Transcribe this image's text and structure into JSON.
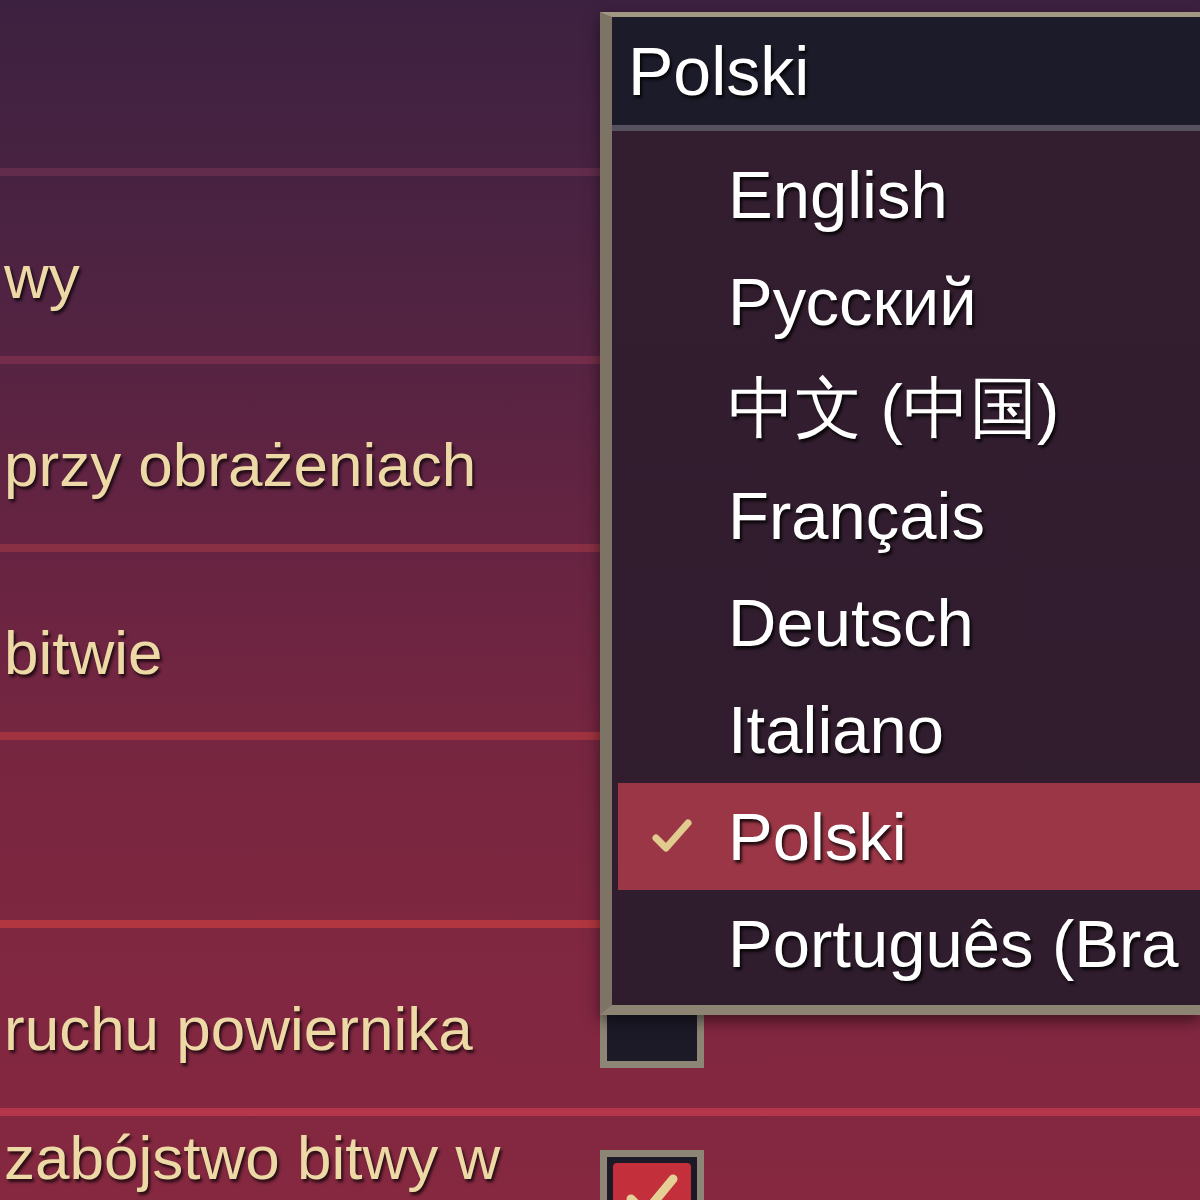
{
  "rows": [
    {
      "kind": "select",
      "value": "Polski",
      "expanded": true,
      "options": [
        {
          "label": "English",
          "selected": false
        },
        {
          "label": "Русский",
          "selected": false
        },
        {
          "label": "中文 (中国)",
          "selected": false
        },
        {
          "label": "Français",
          "selected": false
        },
        {
          "label": "Deutsch",
          "selected": false
        },
        {
          "label": "Italiano",
          "selected": false
        },
        {
          "label": "Polski",
          "selected": true
        },
        {
          "label": "Português (Bra",
          "selected": false
        }
      ]
    },
    {
      "kind": "text",
      "label": "wy"
    },
    {
      "kind": "text",
      "label": "przy obrażeniach"
    },
    {
      "kind": "text",
      "label": "bitwie"
    },
    {
      "kind": "empty"
    },
    {
      "kind": "checkbox",
      "label": "ruchu powiernika",
      "checked": false
    },
    {
      "kind": "checkbox",
      "label": "zabójstwo bitwy w",
      "checked": true
    }
  ]
}
